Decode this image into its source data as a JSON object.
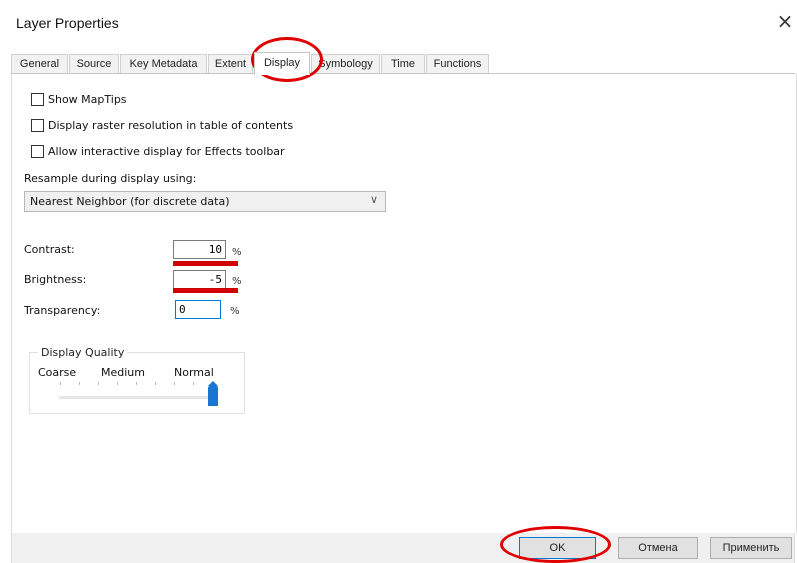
{
  "window": {
    "title": "Layer Properties",
    "close_glyph": "×"
  },
  "tabs": [
    {
      "label": "General"
    },
    {
      "label": "Source"
    },
    {
      "label": "Key Metadata"
    },
    {
      "label": "Extent"
    },
    {
      "label": "Display"
    },
    {
      "label": "Symbology"
    },
    {
      "label": "Time"
    },
    {
      "label": "Functions"
    }
  ],
  "active_tab": "Display",
  "display": {
    "checkboxes": [
      {
        "label": "Show MapTips",
        "checked": false
      },
      {
        "label": "Display raster resolution in table of contents",
        "checked": false
      },
      {
        "label": "Allow interactive display for Effects toolbar",
        "checked": false
      }
    ],
    "resample_label": "Resample during display using:",
    "resample_value": "Nearest Neighbor (for discrete data)",
    "contrast_label": "Contrast:",
    "contrast_value": "10",
    "brightness_label": "Brightness:",
    "brightness_value": "-5",
    "transparency_label": "Transparency:",
    "transparency_value": "0",
    "percent_sign": "%",
    "quality": {
      "title": "Display Quality",
      "labels": [
        "Coarse",
        "Medium",
        "Normal"
      ],
      "selected": "Normal"
    }
  },
  "buttons": {
    "ok": "OK",
    "cancel": "Отмена",
    "apply": "Применить"
  },
  "colors": {
    "annotation_red": "#e00000",
    "slider_blue": "#1a75d2"
  }
}
